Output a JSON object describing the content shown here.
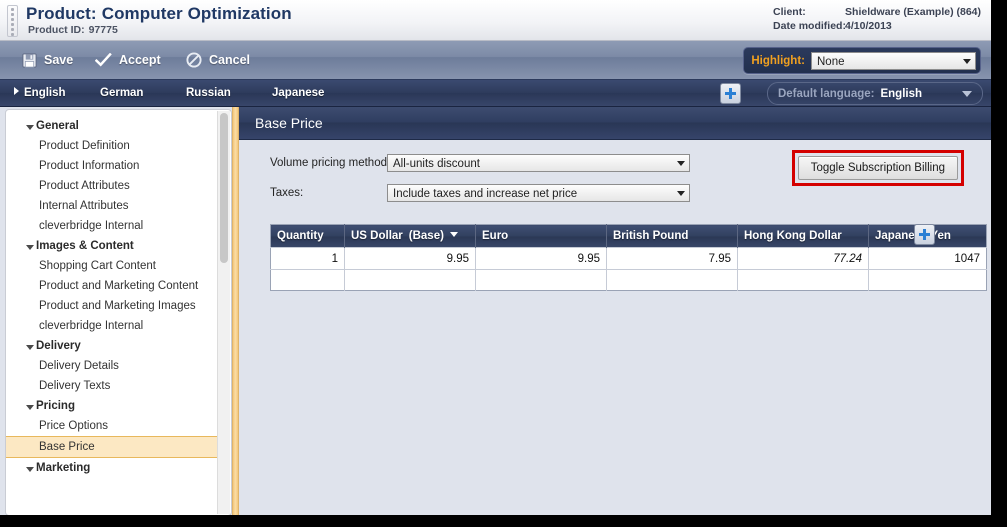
{
  "titlebar": {
    "title_label": "Product:",
    "title_value": "Computer Optimization",
    "product_id_label": "Product ID:",
    "product_id_value": "97775",
    "meta": [
      {
        "key": "Client:",
        "value": "Shieldware (Example) (864)"
      },
      {
        "key": "Date modified:",
        "value": "4/10/2013"
      }
    ]
  },
  "toolbar": {
    "save_label": "Save",
    "accept_label": "Accept",
    "cancel_label": "Cancel",
    "highlight_label": "Highlight:",
    "highlight_value": "None",
    "highlight_options": [
      "None"
    ]
  },
  "langbar": {
    "tabs": [
      {
        "label": "English",
        "active": true
      },
      {
        "label": "German",
        "active": false
      },
      {
        "label": "Russian",
        "active": false
      },
      {
        "label": "Japanese",
        "active": false
      }
    ],
    "add_language_icon": "plus-icon",
    "default_language_label": "Default language:",
    "default_language_value": "English"
  },
  "sidebar": {
    "groups": [
      {
        "label": "General",
        "items": [
          "Product Definition",
          "Product Information",
          "Product Attributes",
          "Internal Attributes",
          "cleverbridge Internal"
        ]
      },
      {
        "label": "Images & Content",
        "items": [
          "Shopping Cart Content",
          "Product and Marketing Content",
          "Product and Marketing Images",
          "cleverbridge Internal"
        ]
      },
      {
        "label": "Delivery",
        "items": [
          "Delivery Details",
          "Delivery Texts"
        ]
      },
      {
        "label": "Pricing",
        "items": [
          "Price Options",
          "Base Price"
        ]
      },
      {
        "label": "Marketing",
        "items": []
      }
    ],
    "active_item": "Base Price"
  },
  "main": {
    "panel_title": "Base Price",
    "fields": [
      {
        "label": "Volume pricing method:",
        "value": "All-units discount",
        "options": [
          "All-units discount"
        ]
      },
      {
        "label": "Taxes:",
        "value": "Include taxes and increase net price",
        "options": [
          "Include taxes and increase net price"
        ]
      }
    ],
    "toggle_button_label": "Toggle Subscription Billing",
    "toggle_highlight_color": "#d40000",
    "add_row_icon": "plus-icon",
    "table": {
      "columns": [
        {
          "label": "Quantity",
          "sorted": false,
          "base": ""
        },
        {
          "label": "US Dollar",
          "sorted": true,
          "base": "(Base)"
        },
        {
          "label": "Euro",
          "sorted": false,
          "base": ""
        },
        {
          "label": "British Pound",
          "sorted": false,
          "base": ""
        },
        {
          "label": "Hong Kong Dollar",
          "sorted": false,
          "base": ""
        },
        {
          "label": "Japanese Yen",
          "sorted": false,
          "base": ""
        }
      ],
      "rows": [
        {
          "quantity": "1",
          "us_dollar": "9.95",
          "euro": "9.95",
          "british_pound": "7.95",
          "hong_kong_dollar": "77.24",
          "hong_kong_dollar_muted": true,
          "japanese_yen": "1047"
        }
      ],
      "empty_row": true
    }
  },
  "colors": {
    "accent_dark_blue": "#2b3855",
    "panel_bg": "#dfe3ec",
    "highlight_orange": "#f0a020",
    "active_nav": "#fce8c3",
    "annotation_red": "#d40000"
  }
}
